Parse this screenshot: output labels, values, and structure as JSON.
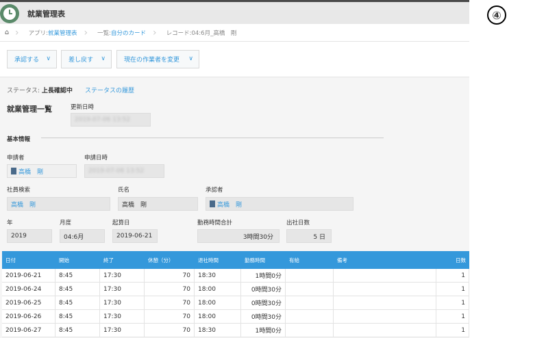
{
  "header": {
    "title": "就業管理表"
  },
  "breadcrumb": [
    {
      "prefix": "アプリ: ",
      "link": "就業管理表"
    },
    {
      "prefix": "一覧: ",
      "link": "自分のカード"
    },
    {
      "prefix": "レコード: ",
      "link": "04:6月_高橋　剛"
    }
  ],
  "actions": {
    "approve": "承認する",
    "reject": "差し戻す",
    "change": "現在の作業者を変更"
  },
  "status": {
    "label": "ステータス: ",
    "value": "上長確認中",
    "history": "ステータスの履歴"
  },
  "form": {
    "section_title": "就業管理一覧",
    "updated_label": "更新日時",
    "updated_value": "2019-07-06 13:52",
    "basic_info": "基本情報",
    "applicant_label": "申請者",
    "applicant_value": "高橋　剛",
    "applied_at_label": "申請日時",
    "applied_at_value": "2019-07-06 13:52",
    "employee_search_label": "社員検索",
    "employee_search_value": "高橋　剛",
    "name_label": "氏名",
    "name_value": "高橋　剛",
    "approver_label": "承認者",
    "approver_value": "高橋　剛",
    "year_label": "年",
    "year_value": "2019",
    "month_label": "月度",
    "month_value": "04:6月",
    "start_date_label": "起算日",
    "start_date_value": "2019-06-21",
    "total_hours_label": "勤務時間合計",
    "total_hours_value": "3時間30分",
    "work_days_label": "出社日数",
    "work_days_value": "5 日"
  },
  "table": {
    "headers": [
      "日付",
      "開始",
      "終了",
      "休憩（分）",
      "退社時間",
      "勤務時間",
      "有給",
      "備考",
      "日数"
    ],
    "rows": [
      [
        "2019-06-21",
        "8:45",
        "17:30",
        "70",
        "18:30",
        "1時間0分",
        "",
        "",
        "1"
      ],
      [
        "2019-06-24",
        "8:45",
        "17:30",
        "70",
        "18:00",
        "0時間30分",
        "",
        "",
        "1"
      ],
      [
        "2019-06-25",
        "8:45",
        "17:30",
        "70",
        "18:00",
        "0時間30分",
        "",
        "",
        "1"
      ],
      [
        "2019-06-26",
        "8:45",
        "17:30",
        "70",
        "18:00",
        "0時間30分",
        "",
        "",
        "1"
      ],
      [
        "2019-06-27",
        "8:45",
        "17:30",
        "70",
        "18:30",
        "1時間0分",
        "",
        "",
        "1"
      ]
    ]
  },
  "badge": "④",
  "icons": {
    "app": "clock-icon",
    "home": "home-icon",
    "chevron": "chevron-down-icon",
    "avatar": "user-avatar-icon"
  }
}
